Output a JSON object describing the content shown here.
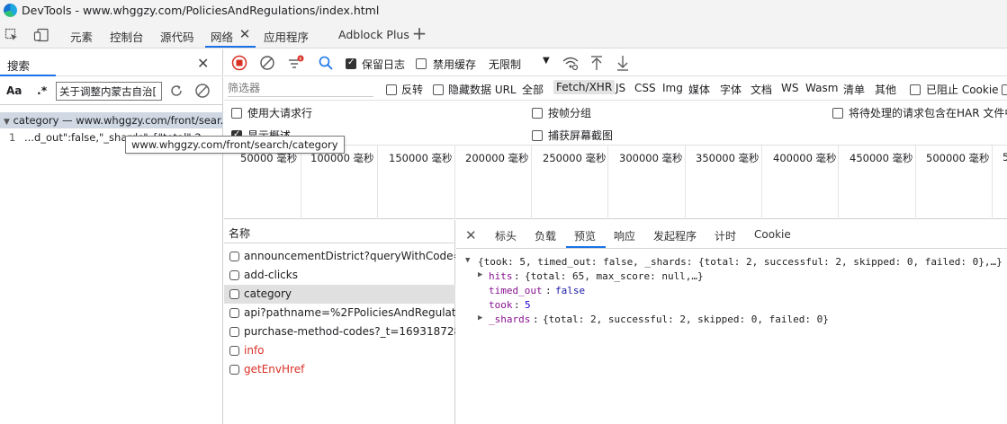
{
  "window": {
    "title": "DevTools - www.whggzy.com/PoliciesAndRegulations/index.html"
  },
  "main_tabs": [
    {
      "label": "元素"
    },
    {
      "label": "控制台"
    },
    {
      "label": "源代码"
    },
    {
      "label": "网络"
    },
    {
      "label": "应用程序"
    },
    {
      "label": "Adblock Plus"
    }
  ],
  "search_panel": {
    "title": "搜索",
    "case_label": "Aa",
    "regex_label": ".*",
    "query": "关于调整内蒙古自治[",
    "result_header": "category — www.whggzy.com/front/sear...",
    "result_line_no": "1",
    "result_line_text": "...d_out\":false,\"_shards\":{\"total\":2,"
  },
  "tooltip": "www.whggzy.com/front/search/category",
  "toolbar": {
    "preserve_log": "保留日志",
    "disable_cache": "禁用缓存",
    "throttle": "无限制"
  },
  "filter": {
    "placeholder": "筛选器",
    "invert": "反转",
    "hide_data_urls": "隐藏数据 URL",
    "types": [
      "全部",
      "Fetch/XHR",
      "JS",
      "CSS",
      "Img",
      "媒体",
      "字体",
      "文档",
      "WS",
      "Wasm",
      "清单",
      "其他"
    ],
    "blocked_cookies": "已阻止 Cookie"
  },
  "options": {
    "big_request_rows": "使用大请求行",
    "group_by_frame": "按帧分组",
    "har_pending": "将待处理的请求包含在HAR 文件中",
    "show_overview": "显示概述",
    "capture_screenshots": "捕获屏幕截图"
  },
  "timeline_ticks": [
    "50000 毫秒",
    "100000 毫秒",
    "150000 毫秒",
    "200000 毫秒",
    "250000 毫秒",
    "300000 毫秒",
    "350000 毫秒",
    "400000 毫秒",
    "450000 毫秒",
    "500000 毫秒",
    "5"
  ],
  "requests": {
    "header": "名称",
    "rows": [
      {
        "name": "announcementDistrict?queryWithCode=t...",
        "state": "normal"
      },
      {
        "name": "add-clicks",
        "state": "normal"
      },
      {
        "name": "category",
        "state": "selected"
      },
      {
        "name": "api?pathname=%2FPoliciesAndRegulatio...",
        "state": "normal"
      },
      {
        "name": "purchase-method-codes?_t=1693187283...",
        "state": "normal"
      },
      {
        "name": "info",
        "state": "error"
      },
      {
        "name": "getEnvHref",
        "state": "error"
      }
    ]
  },
  "detail_tabs": [
    "标头",
    "负载",
    "预览",
    "响应",
    "发起程序",
    "计时",
    "Cookie"
  ],
  "preview": {
    "root": "{took: 5, timed_out: false, _shards: {total: 2, successful: 2, skipped: 0, failed: 0},…}",
    "hits_key": "hits",
    "hits_val": "{total: 65, max_score: null,…}",
    "timed_out_key": "timed_out",
    "timed_out_val": "false",
    "took_key": "took",
    "took_val": "5",
    "shards_key": "_shards",
    "shards_val": "{total: 2, successful: 2, skipped: 0, failed: 0}"
  },
  "colors": {
    "accent": "#1a73e8",
    "error": "#d93025",
    "record": "#d93025"
  }
}
